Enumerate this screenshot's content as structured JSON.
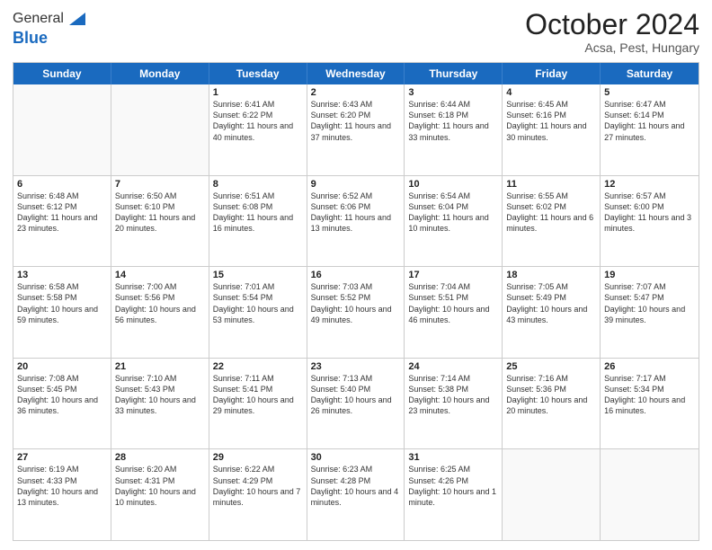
{
  "logo": {
    "general": "General",
    "blue": "Blue"
  },
  "title": "October 2024",
  "location": "Acsa, Pest, Hungary",
  "days": [
    "Sunday",
    "Monday",
    "Tuesday",
    "Wednesday",
    "Thursday",
    "Friday",
    "Saturday"
  ],
  "weeks": [
    [
      {
        "day": "",
        "text": ""
      },
      {
        "day": "",
        "text": ""
      },
      {
        "day": "1",
        "text": "Sunrise: 6:41 AM\nSunset: 6:22 PM\nDaylight: 11 hours and 40 minutes."
      },
      {
        "day": "2",
        "text": "Sunrise: 6:43 AM\nSunset: 6:20 PM\nDaylight: 11 hours and 37 minutes."
      },
      {
        "day": "3",
        "text": "Sunrise: 6:44 AM\nSunset: 6:18 PM\nDaylight: 11 hours and 33 minutes."
      },
      {
        "day": "4",
        "text": "Sunrise: 6:45 AM\nSunset: 6:16 PM\nDaylight: 11 hours and 30 minutes."
      },
      {
        "day": "5",
        "text": "Sunrise: 6:47 AM\nSunset: 6:14 PM\nDaylight: 11 hours and 27 minutes."
      }
    ],
    [
      {
        "day": "6",
        "text": "Sunrise: 6:48 AM\nSunset: 6:12 PM\nDaylight: 11 hours and 23 minutes."
      },
      {
        "day": "7",
        "text": "Sunrise: 6:50 AM\nSunset: 6:10 PM\nDaylight: 11 hours and 20 minutes."
      },
      {
        "day": "8",
        "text": "Sunrise: 6:51 AM\nSunset: 6:08 PM\nDaylight: 11 hours and 16 minutes."
      },
      {
        "day": "9",
        "text": "Sunrise: 6:52 AM\nSunset: 6:06 PM\nDaylight: 11 hours and 13 minutes."
      },
      {
        "day": "10",
        "text": "Sunrise: 6:54 AM\nSunset: 6:04 PM\nDaylight: 11 hours and 10 minutes."
      },
      {
        "day": "11",
        "text": "Sunrise: 6:55 AM\nSunset: 6:02 PM\nDaylight: 11 hours and 6 minutes."
      },
      {
        "day": "12",
        "text": "Sunrise: 6:57 AM\nSunset: 6:00 PM\nDaylight: 11 hours and 3 minutes."
      }
    ],
    [
      {
        "day": "13",
        "text": "Sunrise: 6:58 AM\nSunset: 5:58 PM\nDaylight: 10 hours and 59 minutes."
      },
      {
        "day": "14",
        "text": "Sunrise: 7:00 AM\nSunset: 5:56 PM\nDaylight: 10 hours and 56 minutes."
      },
      {
        "day": "15",
        "text": "Sunrise: 7:01 AM\nSunset: 5:54 PM\nDaylight: 10 hours and 53 minutes."
      },
      {
        "day": "16",
        "text": "Sunrise: 7:03 AM\nSunset: 5:52 PM\nDaylight: 10 hours and 49 minutes."
      },
      {
        "day": "17",
        "text": "Sunrise: 7:04 AM\nSunset: 5:51 PM\nDaylight: 10 hours and 46 minutes."
      },
      {
        "day": "18",
        "text": "Sunrise: 7:05 AM\nSunset: 5:49 PM\nDaylight: 10 hours and 43 minutes."
      },
      {
        "day": "19",
        "text": "Sunrise: 7:07 AM\nSunset: 5:47 PM\nDaylight: 10 hours and 39 minutes."
      }
    ],
    [
      {
        "day": "20",
        "text": "Sunrise: 7:08 AM\nSunset: 5:45 PM\nDaylight: 10 hours and 36 minutes."
      },
      {
        "day": "21",
        "text": "Sunrise: 7:10 AM\nSunset: 5:43 PM\nDaylight: 10 hours and 33 minutes."
      },
      {
        "day": "22",
        "text": "Sunrise: 7:11 AM\nSunset: 5:41 PM\nDaylight: 10 hours and 29 minutes."
      },
      {
        "day": "23",
        "text": "Sunrise: 7:13 AM\nSunset: 5:40 PM\nDaylight: 10 hours and 26 minutes."
      },
      {
        "day": "24",
        "text": "Sunrise: 7:14 AM\nSunset: 5:38 PM\nDaylight: 10 hours and 23 minutes."
      },
      {
        "day": "25",
        "text": "Sunrise: 7:16 AM\nSunset: 5:36 PM\nDaylight: 10 hours and 20 minutes."
      },
      {
        "day": "26",
        "text": "Sunrise: 7:17 AM\nSunset: 5:34 PM\nDaylight: 10 hours and 16 minutes."
      }
    ],
    [
      {
        "day": "27",
        "text": "Sunrise: 6:19 AM\nSunset: 4:33 PM\nDaylight: 10 hours and 13 minutes."
      },
      {
        "day": "28",
        "text": "Sunrise: 6:20 AM\nSunset: 4:31 PM\nDaylight: 10 hours and 10 minutes."
      },
      {
        "day": "29",
        "text": "Sunrise: 6:22 AM\nSunset: 4:29 PM\nDaylight: 10 hours and 7 minutes."
      },
      {
        "day": "30",
        "text": "Sunrise: 6:23 AM\nSunset: 4:28 PM\nDaylight: 10 hours and 4 minutes."
      },
      {
        "day": "31",
        "text": "Sunrise: 6:25 AM\nSunset: 4:26 PM\nDaylight: 10 hours and 1 minute."
      },
      {
        "day": "",
        "text": ""
      },
      {
        "day": "",
        "text": ""
      }
    ]
  ]
}
